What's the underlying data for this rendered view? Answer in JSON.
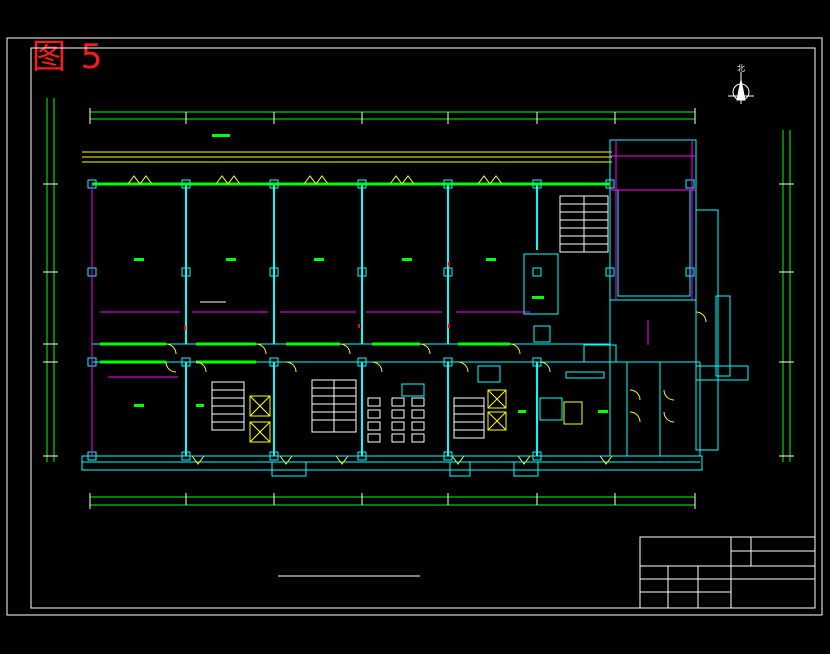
{
  "figure_label": "图 5",
  "north_label": "北",
  "colors": {
    "background": "#000000",
    "frame": "#ffffff",
    "wall": "#00ffff",
    "window": "#ffff00",
    "corridor": "#00ff00",
    "dimension": "#00ff00",
    "extension": "#ffffff",
    "furniture": "#ff00ff",
    "figure_label": "#ff1a1a"
  }
}
